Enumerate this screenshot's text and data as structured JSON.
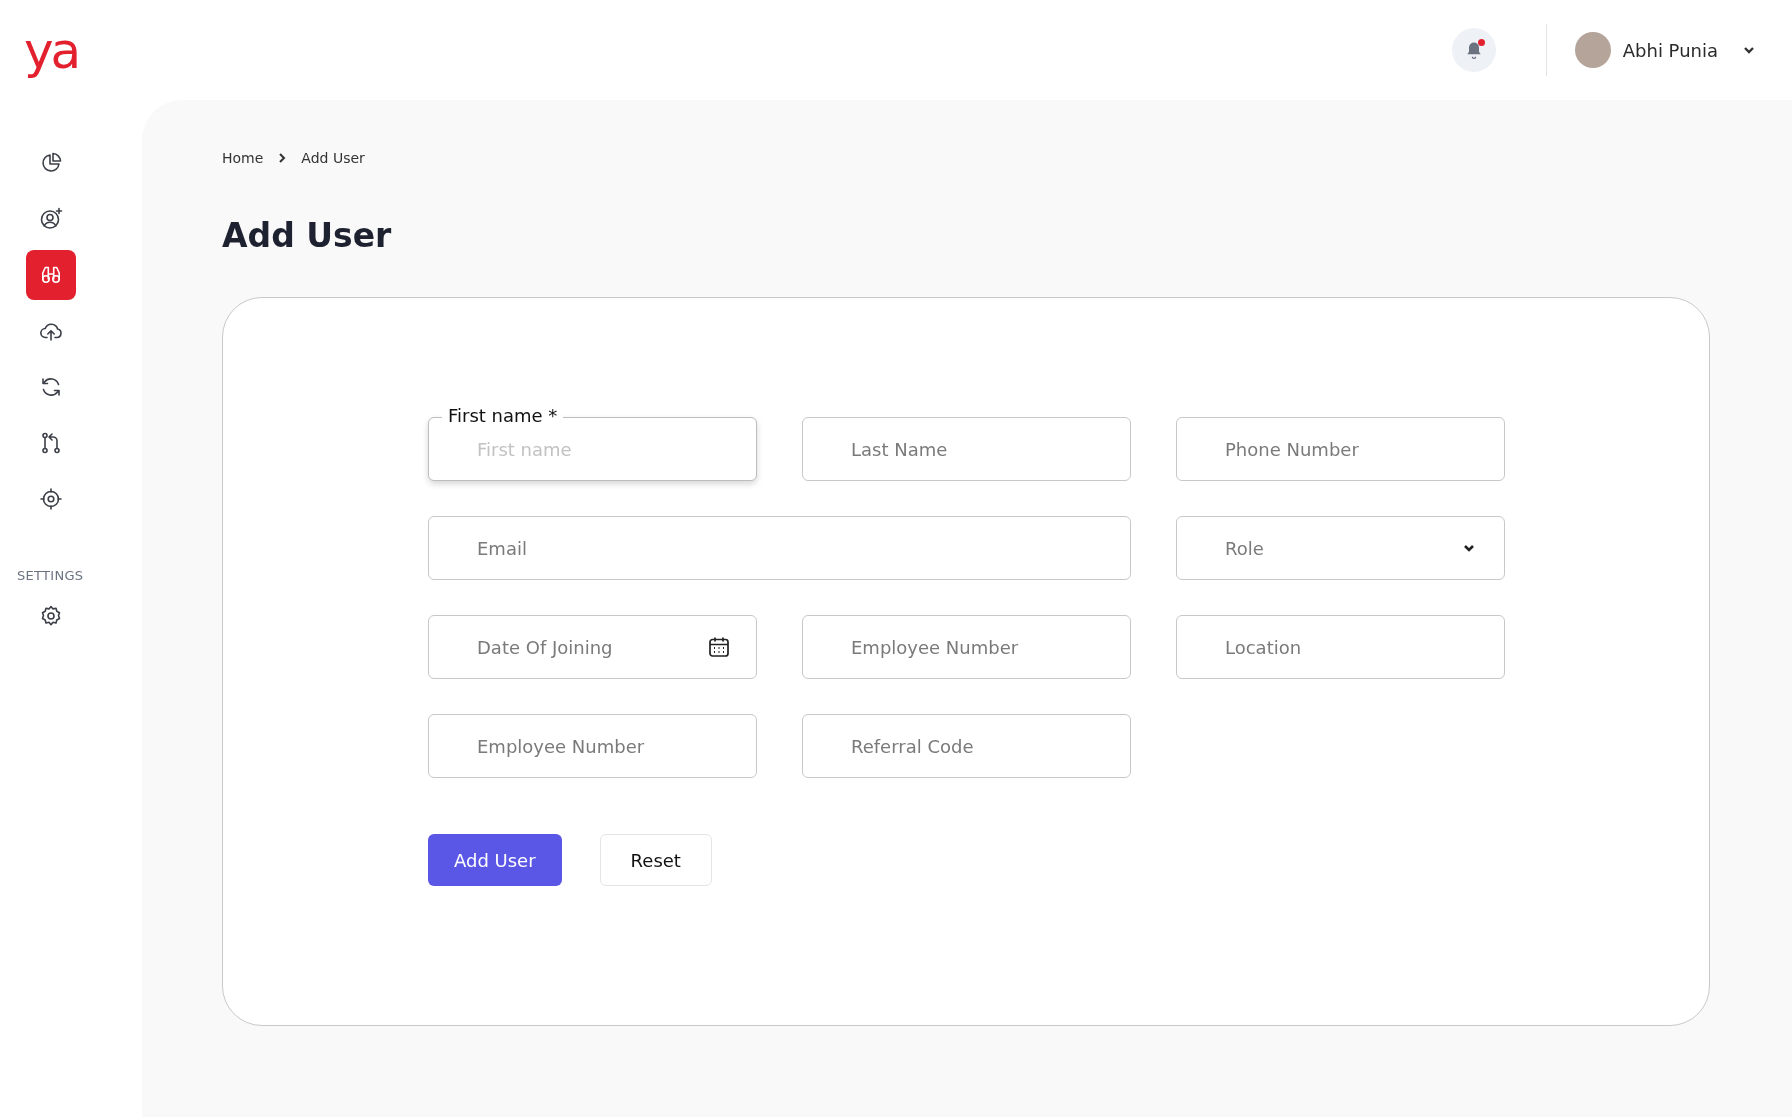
{
  "logo": "ya",
  "nav": {
    "items": [
      {
        "kind": "chart",
        "selected": false
      },
      {
        "kind": "user-add",
        "selected": false
      },
      {
        "kind": "binoculars",
        "selected": true
      },
      {
        "kind": "cloud-upload",
        "selected": false
      },
      {
        "kind": "sync",
        "selected": false
      },
      {
        "kind": "merge",
        "selected": false
      },
      {
        "kind": "target",
        "selected": false
      }
    ],
    "settings": {
      "label": "SETTINGS",
      "items": [
        {
          "kind": "gear",
          "selected": false
        }
      ]
    }
  },
  "header": {
    "notifications": {
      "unread": true
    },
    "user": {
      "name": "Abhi Punia"
    }
  },
  "breadcrumb": [
    "Home",
    "Add User"
  ],
  "title": "Add User",
  "form": {
    "fields": [
      {
        "kind": "text",
        "label": "First name *",
        "placeholder": "First name",
        "focused": true,
        "wide": false
      },
      {
        "kind": "text",
        "placeholder": "Last Name",
        "focused": false,
        "wide": false
      },
      {
        "kind": "text",
        "placeholder": "Phone Number",
        "focused": false,
        "wide": false
      },
      {
        "kind": "text",
        "placeholder": "Email",
        "focused": false,
        "wide": true
      },
      {
        "kind": "select",
        "placeholder": "Role",
        "focused": false,
        "wide": false
      },
      {
        "kind": "date",
        "placeholder": "Date Of Joining",
        "focused": false,
        "wide": false
      },
      {
        "kind": "text",
        "placeholder": "Employee Number",
        "focused": false,
        "wide": false
      },
      {
        "kind": "text",
        "placeholder": "Location",
        "focused": false,
        "wide": false
      },
      {
        "kind": "text",
        "placeholder": "Employee Number",
        "focused": false,
        "wide": false
      },
      {
        "kind": "text",
        "placeholder": "Referral Code",
        "focused": false,
        "wide": false
      }
    ],
    "buttons": [
      {
        "kind": "primary",
        "label": "Add User"
      },
      {
        "kind": "secondary",
        "label": "Reset"
      }
    ]
  }
}
